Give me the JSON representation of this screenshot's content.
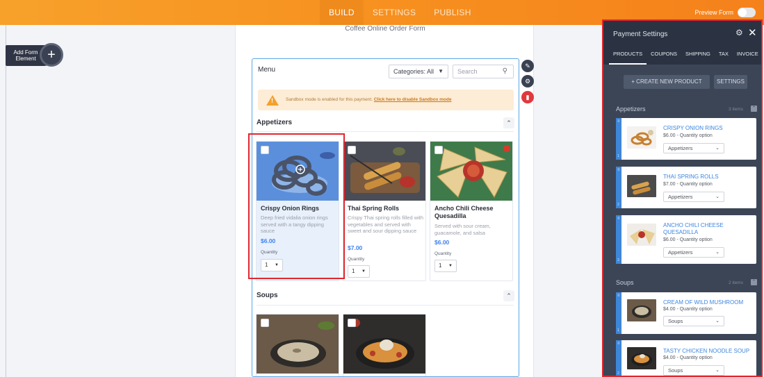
{
  "topbar": {
    "tabs": [
      "BUILD",
      "SETTINGS",
      "PUBLISH"
    ],
    "preview_label": "Preview Form"
  },
  "left": {
    "add_element_label": "Add Form Element",
    "add_icon": "+"
  },
  "form": {
    "title": "Coffee Online Order Form",
    "widget": {
      "menu_label": "Menu",
      "category_select": "Categories: All",
      "search_placeholder": "Search",
      "sandbox_text": "Sandbox mode is enabled for this payment.",
      "sandbox_link": "Click here to disable Sandbox mode",
      "sections": [
        {
          "title": "Appetizers",
          "items": [
            {
              "name": "Crispy Onion Rings",
              "desc": "Deep fried vidalia onion rings served with a tangy dipping sauce",
              "price": "$6.00",
              "qty_label": "Quantity",
              "qty": "1"
            },
            {
              "name": "Thai Spring Rolls",
              "desc": "Crispy Thai spring rolls filled with vegetables and served with sweet and sour dipping sauce",
              "price": "$7.00",
              "qty_label": "Quantity",
              "qty": "1"
            },
            {
              "name": "Ancho Chili Cheese Quesadilla",
              "desc": "Served with sour cream, guacamole, and salsa",
              "price": "$6.00",
              "qty_label": "Quantity",
              "qty": "1"
            }
          ]
        },
        {
          "title": "Soups",
          "items": []
        }
      ]
    }
  },
  "panel": {
    "title": "Payment Settings",
    "tabs": [
      "PRODUCTS",
      "COUPONS",
      "SHIPPING",
      "TAX",
      "INVOICE"
    ],
    "create_label": "+ CREATE NEW PRODUCT",
    "settings_label": "SETTINGS",
    "groups": [
      {
        "label": "Appetizers",
        "count": "3 items",
        "items": [
          {
            "name": "CRISPY ONION RINGS",
            "meta": "$6.00 - Quantity option",
            "category": "Appetizers",
            "index": "1"
          },
          {
            "name": "THAI SPRING ROLLS",
            "meta": "$7.00 - Quantity option",
            "category": "Appetizers",
            "index": "2"
          },
          {
            "name": "ANCHO CHILI CHEESE QUESADILLA",
            "meta": "$6.00 - Quantity option",
            "category": "Appetizers",
            "index": "3"
          }
        ]
      },
      {
        "label": "Soups",
        "count": "2 items",
        "items": [
          {
            "name": "CREAM OF WILD MUSHROOM",
            "meta": "$4.00 - Quantity option",
            "category": "Soups",
            "index": "1"
          },
          {
            "name": "TASTY CHICKEN NOODLE SOUP",
            "meta": "$4.00 - Quantity option",
            "category": "Soups",
            "index": "2"
          }
        ]
      }
    ]
  },
  "colors": {
    "accent_orange": "#f79220",
    "panel_bg": "#3b4556",
    "link_blue": "#3b86e0",
    "price_blue": "#3f82f0",
    "highlight_red": "#e0262f"
  }
}
